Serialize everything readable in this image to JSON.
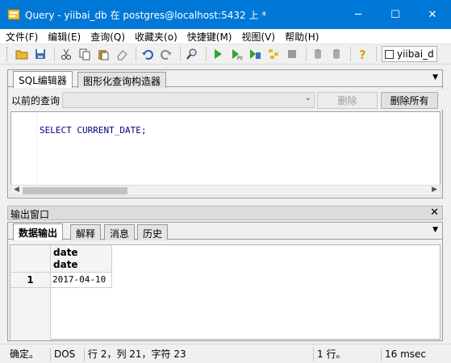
{
  "window": {
    "title": "Query - yiibai_db 在  postgres@localhost:5432 上 *",
    "minimize": "─",
    "maximize": "☐",
    "close": "✕"
  },
  "menu": [
    "文件(F)",
    "编辑(E)",
    "查询(Q)",
    "收藏夹(o)",
    "快捷键(M)",
    "视图(V)",
    "帮助(H)"
  ],
  "toolbar": {
    "icons": [
      "open-folder-icon",
      "save-icon",
      "cut-icon",
      "copy-icon",
      "paste-icon",
      "eraser-icon",
      "undo-icon",
      "redo-icon",
      "find-icon",
      "execute-icon",
      "execute-pgscript-icon",
      "execute-to-file-icon",
      "explain-icon",
      "stop-icon",
      "commit-icon",
      "rollback-icon",
      "help-icon"
    ],
    "db_combo_text": "yiibai_d"
  },
  "sql_tabs": [
    "SQL编辑器",
    "图形化查询构造器"
  ],
  "previous_queries": {
    "label": "以前的查询",
    "value": "",
    "delete_button": "删除",
    "delete_all_button": "删除所有"
  },
  "editor": {
    "sql": "SELECT CURRENT_DATE;"
  },
  "output": {
    "title": "输出窗口",
    "close": "✕",
    "tabs": [
      "数据输出",
      "解释",
      "消息",
      "历史"
    ],
    "columns": [
      {
        "name": "date",
        "type": "date"
      }
    ],
    "rows": [
      {
        "num": "1",
        "values": [
          "2017-04-10"
        ]
      }
    ]
  },
  "status": {
    "state": "确定。",
    "format": "DOS",
    "cursor": "行 2，列 21，字符 23",
    "rows": "1 行。",
    "time": "16 msec"
  },
  "colors": {
    "titlebar": "#0078d7",
    "sql_keyword": "#00008b"
  }
}
